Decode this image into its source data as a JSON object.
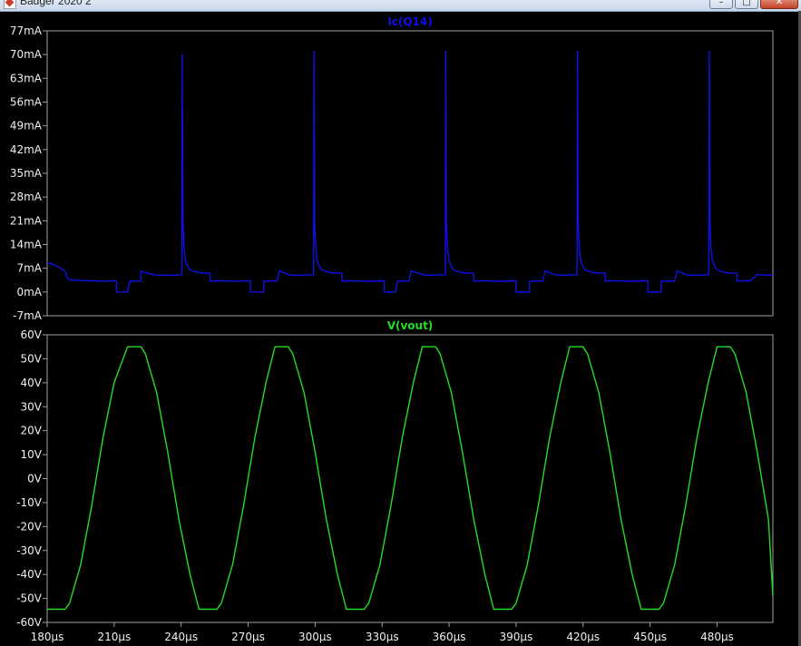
{
  "window": {
    "title": "Badger 2020 2",
    "minimize_glyph": "–",
    "maximize_glyph": "□",
    "close_glyph": "✕"
  },
  "colors": {
    "background": "#000000",
    "frame": "#a0a0a0",
    "text": "#f0f0f0",
    "trace_current": "#1010e8",
    "trace_voltage": "#22dd22"
  },
  "chart_data": [
    {
      "type": "line",
      "title": "Ic(Q14)",
      "xlim": [
        180,
        505
      ],
      "ylim": [
        -7,
        77
      ],
      "y_ticks": [
        "77mA",
        "70mA",
        "63mA",
        "56mA",
        "49mA",
        "42mA",
        "35mA",
        "28mA",
        "21mA",
        "14mA",
        "7mA",
        "0mA",
        "-7mA"
      ],
      "series": [
        {
          "name": "Ic(Q14)",
          "units": "mA",
          "x": [
            180,
            181,
            182,
            183,
            184,
            185,
            186,
            187,
            188,
            189,
            190,
            195,
            200,
            205,
            210,
            211,
            211,
            216,
            217,
            222,
            222,
            227,
            228,
            238,
            238,
            240.3,
            240.5,
            240.8,
            241.3,
            242,
            243,
            244,
            246,
            248,
            250,
            252,
            253,
            253,
            255,
            256,
            265,
            270,
            271,
            271,
            277,
            277,
            283,
            284,
            288,
            288,
            294,
            295,
            299.3,
            299.5,
            299.8,
            300.3,
            301,
            302,
            303,
            305,
            307,
            309,
            311,
            312,
            312,
            314,
            315,
            324,
            330,
            331,
            331,
            336,
            337,
            342,
            343,
            348,
            349,
            353,
            354,
            358.3,
            358.5,
            358.8,
            359.3,
            360,
            361,
            362,
            364,
            366,
            368,
            370,
            371,
            371,
            373,
            374,
            383,
            389,
            390,
            390,
            396,
            396,
            402,
            403,
            407,
            408,
            413,
            413,
            417.3,
            417.5,
            417.8,
            418.3,
            419,
            420,
            421,
            423,
            425,
            427,
            429,
            430,
            430,
            432,
            433,
            442,
            448,
            449,
            449,
            455,
            455,
            461,
            462,
            466,
            466,
            472,
            473,
            476.3,
            476.5,
            476.8,
            477.3,
            478,
            479,
            480,
            482,
            484,
            486,
            488,
            489,
            489,
            491,
            492,
            495,
            498,
            501,
            505
          ],
          "y": [
            8.6,
            8.5,
            8.3,
            8,
            7.7,
            7.4,
            7,
            6.6,
            6.1,
            4.2,
            3.6,
            3.4,
            3.3,
            3.2,
            3.3,
            3.3,
            0,
            0,
            3.2,
            3.3,
            6.1,
            5.2,
            5,
            4.9,
            5,
            5.1,
            70,
            20,
            13,
            9,
            7.5,
            6.5,
            6,
            5.7,
            5.6,
            5.6,
            5.5,
            3.2,
            3.3,
            3.3,
            3.2,
            3.3,
            3.3,
            0,
            0,
            3.2,
            3.3,
            6.2,
            5.2,
            5,
            4.9,
            5,
            5.1,
            71,
            20,
            13,
            9,
            7.5,
            6.5,
            6,
            5.7,
            5.6,
            5.6,
            5.5,
            3.2,
            3.3,
            3.3,
            3.2,
            3.3,
            3.3,
            0,
            0,
            3.2,
            3.3,
            6.2,
            5.2,
            5,
            4.9,
            5,
            5.1,
            71,
            20,
            13,
            9,
            7.5,
            6.5,
            6,
            5.7,
            5.6,
            5.6,
            5.5,
            3.2,
            3.3,
            3.3,
            3.2,
            3.3,
            3.3,
            0,
            0,
            3.2,
            3.3,
            6.2,
            5.2,
            5,
            4.9,
            5,
            5.1,
            71,
            20,
            13,
            9,
            7.5,
            6.5,
            6,
            5.7,
            5.6,
            5.6,
            5.5,
            3.2,
            3.3,
            3.3,
            3.2,
            3.3,
            3.3,
            0,
            0,
            3.2,
            3.3,
            6.2,
            5.2,
            5,
            4.9,
            5,
            5.1,
            71,
            20,
            13,
            9,
            7.5,
            6.5,
            6,
            5.7,
            5.6,
            5.6,
            5.5,
            3.2,
            3.3,
            3.3,
            3.3,
            5.2,
            5,
            4.9
          ]
        }
      ],
      "grid": false,
      "legend": "top-center"
    },
    {
      "type": "line",
      "title": "V(vout)",
      "xlabel": "",
      "xlim": [
        180,
        505
      ],
      "ylim": [
        -60,
        60
      ],
      "y_ticks": [
        "60V",
        "50V",
        "40V",
        "30V",
        "20V",
        "10V",
        "0V",
        "-10V",
        "-20V",
        "-30V",
        "-40V",
        "-50V",
        "-60V"
      ],
      "x_ticks": [
        "180µs",
        "210µs",
        "240µs",
        "270µs",
        "300µs",
        "330µs",
        "360µs",
        "390µs",
        "420µs",
        "450µs",
        "480µs"
      ],
      "x_tick_values": [
        180,
        210,
        240,
        270,
        300,
        330,
        360,
        390,
        420,
        450,
        480
      ],
      "series": [
        {
          "name": "V(vout)",
          "units": "V",
          "x": [
            180,
            188,
            190,
            195,
            200,
            205,
            210,
            216,
            217,
            222,
            224,
            229,
            234,
            239,
            244,
            248,
            249,
            256,
            258,
            263,
            268,
            273,
            278,
            282,
            283,
            288,
            290,
            295,
            300,
            305,
            310,
            314,
            315,
            322,
            324,
            329,
            334,
            339,
            344,
            348,
            349,
            354,
            356,
            361,
            366,
            371,
            376,
            380,
            381,
            388,
            390,
            395,
            400,
            405,
            410,
            414,
            415,
            420,
            422,
            427,
            432,
            437,
            442,
            446,
            447,
            454,
            456,
            461,
            466,
            471,
            476,
            480,
            481,
            486,
            488,
            493,
            498,
            503,
            505
          ],
          "y": [
            -54.5,
            -54.5,
            -52,
            -36,
            -11,
            17,
            40,
            55,
            55,
            55,
            52,
            36,
            11,
            -17,
            -40,
            -54.5,
            -54.5,
            -54.5,
            -52,
            -36,
            -11,
            17,
            40,
            55,
            55,
            55,
            52,
            36,
            11,
            -17,
            -40,
            -54.5,
            -54.5,
            -54.5,
            -52,
            -36,
            -11,
            17,
            40,
            55,
            55,
            55,
            52,
            36,
            11,
            -17,
            -40,
            -54.5,
            -54.5,
            -54.5,
            -52,
            -36,
            -11,
            17,
            40,
            55,
            55,
            55,
            52,
            36,
            11,
            -17,
            -40,
            -54.5,
            -54.5,
            -54.5,
            -52,
            -36,
            -11,
            17,
            40,
            55,
            55,
            55,
            52,
            36,
            11,
            -17,
            -49
          ]
        }
      ],
      "grid": false,
      "legend": "top-center"
    }
  ]
}
